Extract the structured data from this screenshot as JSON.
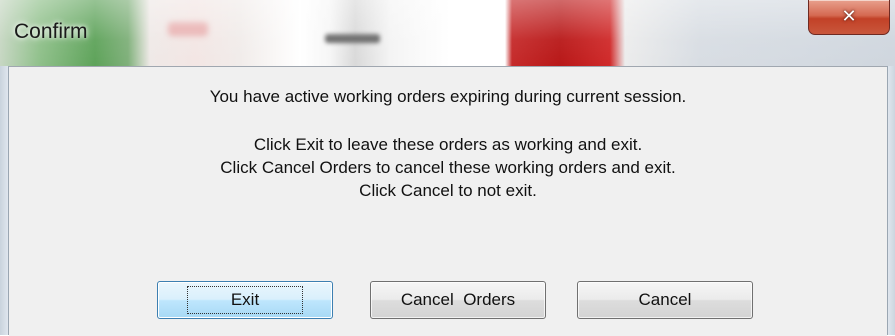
{
  "window": {
    "title": "Confirm",
    "close_glyph": "✕"
  },
  "message": {
    "line1": "You have active working orders expiring during current session.",
    "line2": "Click Exit to leave these orders as working and exit.",
    "line3": "Click Cancel Orders to cancel these working orders and exit.",
    "line4": "Click Cancel to not exit."
  },
  "buttons": {
    "exit": "Exit",
    "cancel_orders": "Cancel  Orders",
    "cancel": "Cancel"
  },
  "colors": {
    "close_button": "#c9573c",
    "client_background": "#f0f0f0",
    "default_button_border": "#3c7fb1"
  }
}
